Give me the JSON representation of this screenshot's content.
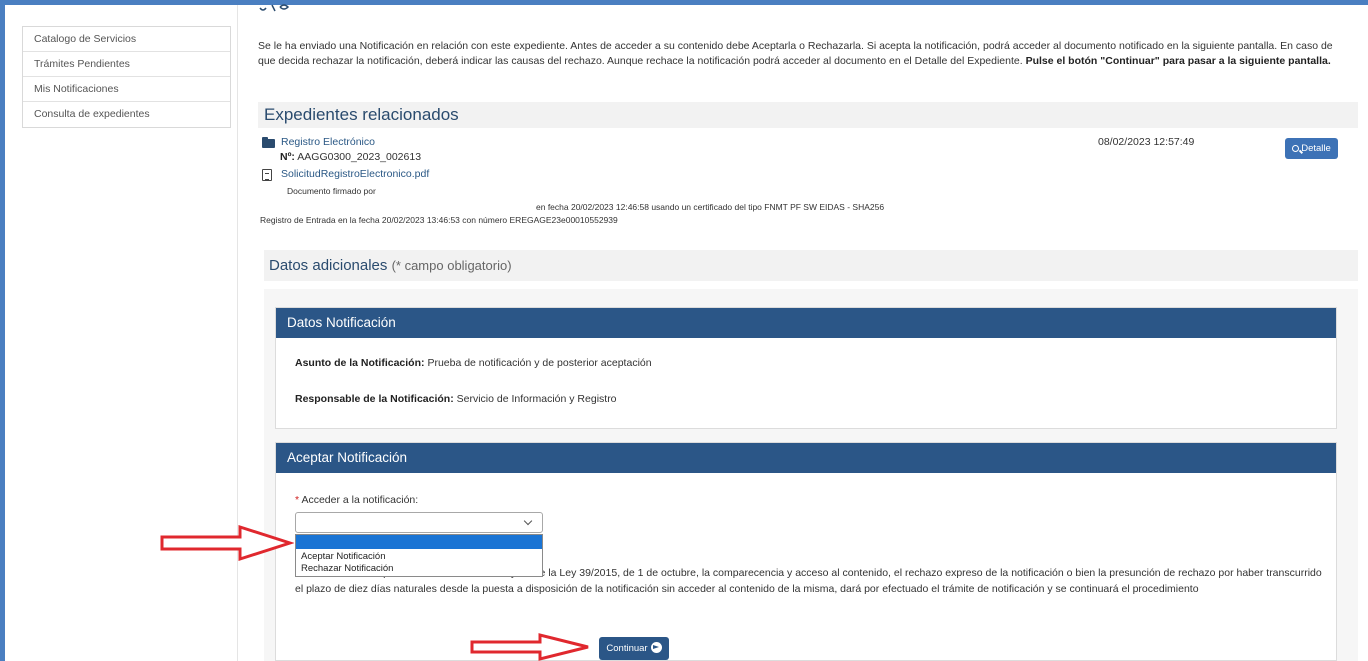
{
  "sidebar": {
    "items": [
      {
        "label": "Catalogo de Servicios"
      },
      {
        "label": "Trámites Pendientes"
      },
      {
        "label": "Mis Notificaciones"
      },
      {
        "label": "Consulta de expedientes"
      }
    ]
  },
  "main": {
    "intro_text": "Se le ha enviado una Notificación en relación con este expediente. Antes de acceder a su contenido debe Aceptarla o Rechazarla. Si acepta la notificación, podrá acceder al documento notificado en la siguiente pantalla. En caso de que decida rechazar la notificación, deberá indicar las causas del rechazo. Aunque rechace la notificación podrá acceder al documento en el Detalle del Expediente.",
    "intro_bold": "Pulse el botón \"Continuar\" para pasar a la siguiente pantalla.",
    "related_title": "Expedientes relacionados",
    "record": {
      "title": "Registro Electrónico",
      "number_label": "Nº:",
      "number": "AAGG0300_2023_002613",
      "date": "08/02/2023 12:57:49",
      "detail_label": "Detalle",
      "document": {
        "filename": "SolicitudRegistroElectronico.pdf",
        "signed_by": "Documento firmado por",
        "certificate_line": "en fecha 20/02/2023 12:46:58  usando un certificado del tipo  FNMT PF SW EIDAS - SHA256",
        "registry_line": "Registro de Entrada en la fecha 20/02/2023 13:46:53 con número  EREGAGE23e00010552939"
      }
    },
    "additional": {
      "title": "Datos adicionales",
      "note": "(* campo obligatorio)"
    },
    "notification_card": {
      "title": "Datos Notificación",
      "subject_label": "Asunto de la Notificación:",
      "subject_value": "Prueba de notificación y de posterior aceptación",
      "responsible_label": "Responsable de la Notificación:",
      "responsible_value": "Servicio de Información y Registro"
    },
    "accept_card": {
      "title": "Aceptar Notificación",
      "required_mark": "*",
      "access_label": "Acceder a la notificación:",
      "select_value": "",
      "options": [
        "",
        "Aceptar Notificación",
        "Rechazar Notificación"
      ],
      "legal_text": "De acuerdo con lo previsto en los artículos 41 y 43 de la Ley 39/2015, de 1 de octubre, la comparecencia y acceso al contenido, el rechazo expreso de la notificación o bien la presunción de rechazo por haber transcurrido el plazo de diez días naturales desde la puesta a disposición de la notificación sin acceder al contenido de la misma, dará por efectuado el trámite de notificación y se continuará el procedimiento",
      "continue_label": "Continuar"
    }
  },
  "colors": {
    "frame": "#4a7fc1",
    "card_header": "#2b5687",
    "heading": "#2a4b6e",
    "dropdown_highlight": "#1a74d4",
    "annotation_arrow": "#e0282e"
  },
  "icons": [
    "folder-icon",
    "search-icon",
    "document-icon",
    "chevron-down-icon",
    "arrow-right-circle-icon",
    "annotation-arrow-icon"
  ]
}
